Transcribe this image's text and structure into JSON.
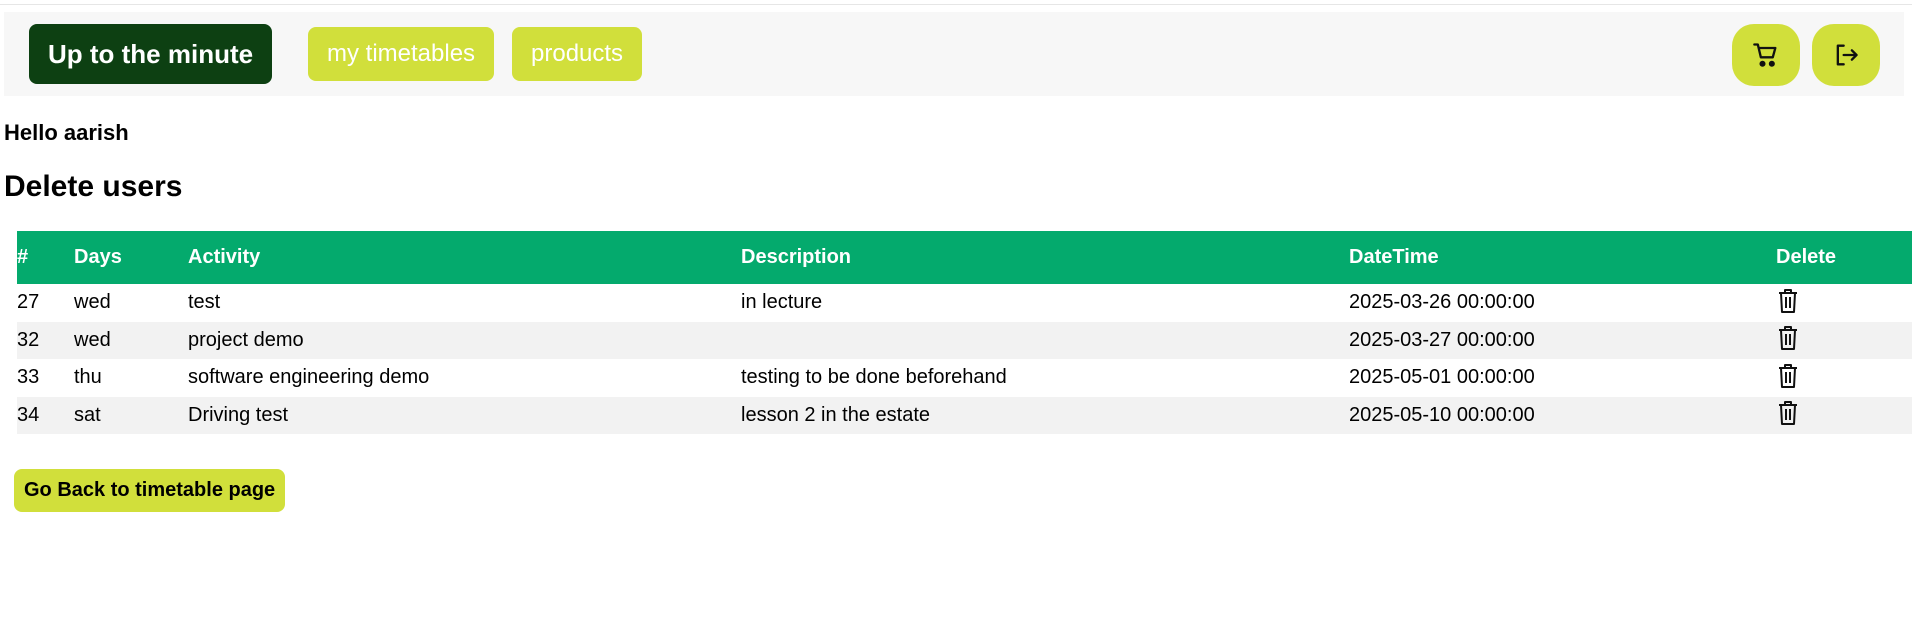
{
  "nav": {
    "brand": "Up to the minute",
    "links": [
      "my timetables",
      "products"
    ],
    "cart_icon": "cart-icon",
    "logout_icon": "logout-icon"
  },
  "greeting": "Hello aarish",
  "heading": "Delete users",
  "table": {
    "headers": [
      "#",
      "Days",
      "Activity",
      "Description",
      "DateTime",
      "Delete"
    ],
    "rows": [
      {
        "id": "27",
        "day": "wed",
        "activity": "test",
        "description": "in lecture",
        "datetime": "2025-03-26 00:00:00"
      },
      {
        "id": "32",
        "day": "wed",
        "activity": "project demo",
        "description": "",
        "datetime": "2025-03-27 00:00:00"
      },
      {
        "id": "33",
        "day": "thu",
        "activity": "software engineering demo",
        "description": "testing to be done beforehand",
        "datetime": "2025-05-01 00:00:00"
      },
      {
        "id": "34",
        "day": "sat",
        "activity": "Driving test",
        "description": "lesson 2 in the estate",
        "datetime": "2025-05-10 00:00:00"
      }
    ],
    "delete_icon": "trash-icon"
  },
  "back_button": "Go Back to timetable page",
  "colors": {
    "brand_bg": "#0d4012",
    "accent": "#d1df3b",
    "table_header": "#04aa6d",
    "row_stripe": "#f2f2f2",
    "navbar_bg": "#f7f7f7"
  }
}
